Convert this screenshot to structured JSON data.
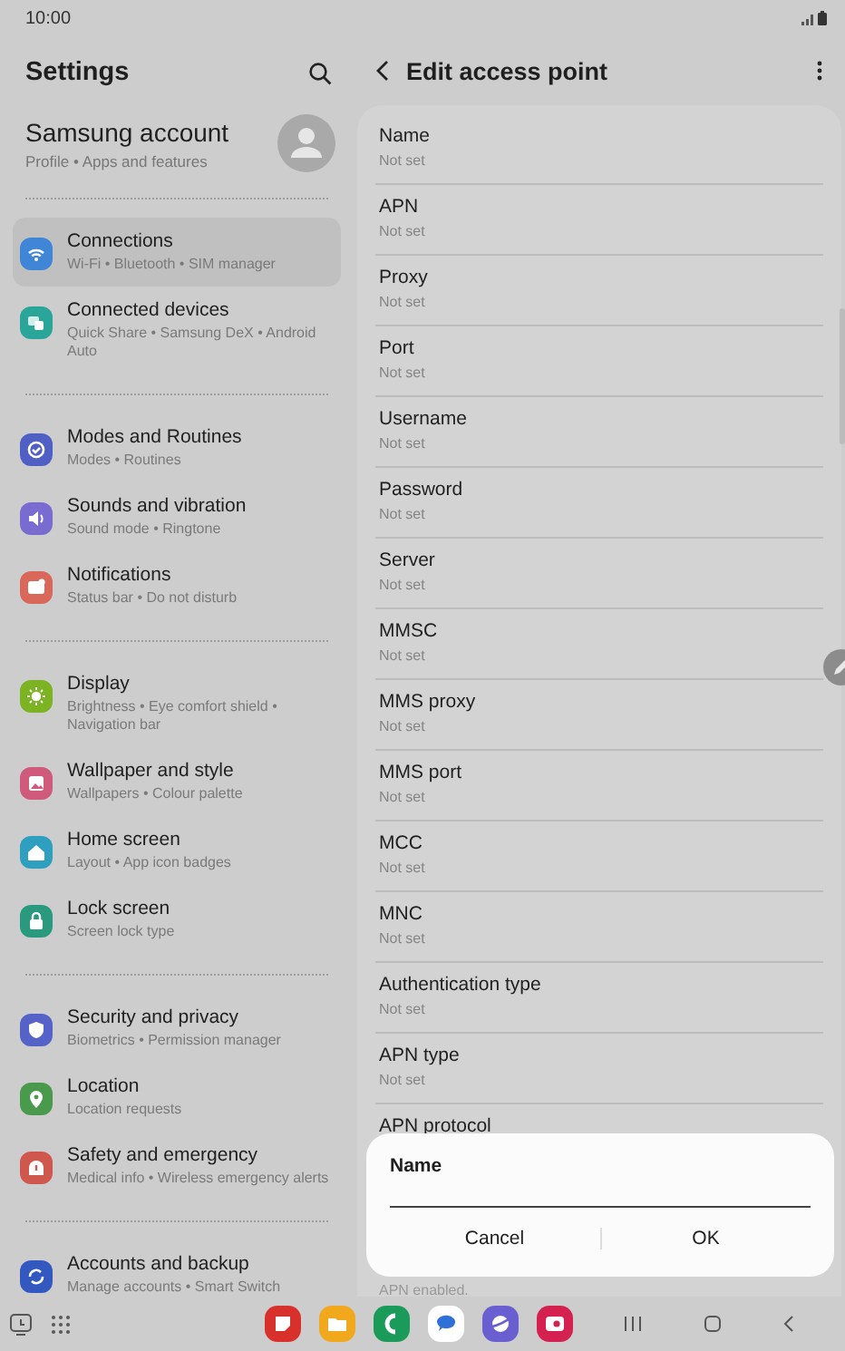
{
  "status_bar": {
    "time": "10:00"
  },
  "settings": {
    "title": "Settings",
    "account": {
      "name": "Samsung account",
      "subtitle": "Profile  •  Apps and features"
    },
    "groups": [
      [
        {
          "title": "Connections",
          "subtitle": "Wi-Fi  •  Bluetooth  •  SIM manager",
          "selected": true,
          "color": "#3f86d6"
        },
        {
          "title": "Connected devices",
          "subtitle": "Quick Share  •  Samsung DeX  •  Android Auto",
          "selected": false,
          "color": "#2aa59a"
        }
      ],
      [
        {
          "title": "Modes and Routines",
          "subtitle": "Modes  •  Routines",
          "selected": false,
          "color": "#4f5fc4"
        },
        {
          "title": "Sounds and vibration",
          "subtitle": "Sound mode  •  Ringtone",
          "selected": false,
          "color": "#7a6bd0"
        },
        {
          "title": "Notifications",
          "subtitle": "Status bar  •  Do not disturb",
          "selected": false,
          "color": "#d9675a"
        }
      ],
      [
        {
          "title": "Display",
          "subtitle": "Brightness  •  Eye comfort shield  •  Navigation bar",
          "selected": false,
          "color": "#7cb322"
        },
        {
          "title": "Wallpaper and style",
          "subtitle": "Wallpapers  •  Colour palette",
          "selected": false,
          "color": "#cf5a7c"
        },
        {
          "title": "Home screen",
          "subtitle": "Layout  •  App icon badges",
          "selected": false,
          "color": "#2f9fc0"
        },
        {
          "title": "Lock screen",
          "subtitle": "Screen lock type",
          "selected": false,
          "color": "#2a9a7e"
        }
      ],
      [
        {
          "title": "Security and privacy",
          "subtitle": "Biometrics  •  Permission manager",
          "selected": false,
          "color": "#5563c8"
        },
        {
          "title": "Location",
          "subtitle": "Location requests",
          "selected": false,
          "color": "#4a9a4e"
        },
        {
          "title": "Safety and emergency",
          "subtitle": "Medical info  •  Wireless emergency alerts",
          "selected": false,
          "color": "#cf574e"
        }
      ],
      [
        {
          "title": "Accounts and backup",
          "subtitle": "Manage accounts  •  Smart Switch",
          "selected": false,
          "color": "#3358c0"
        }
      ]
    ]
  },
  "edit": {
    "title": "Edit access point",
    "fields": [
      {
        "label": "Name",
        "value": "Not set"
      },
      {
        "label": "APN",
        "value": "Not set"
      },
      {
        "label": "Proxy",
        "value": "Not set"
      },
      {
        "label": "Port",
        "value": "Not set"
      },
      {
        "label": "Username",
        "value": "Not set"
      },
      {
        "label": "Password",
        "value": "Not set"
      },
      {
        "label": "Server",
        "value": "Not set"
      },
      {
        "label": "MMSC",
        "value": "Not set"
      },
      {
        "label": "MMS proxy",
        "value": "Not set"
      },
      {
        "label": "MMS port",
        "value": "Not set"
      },
      {
        "label": "MCC",
        "value": "Not set"
      },
      {
        "label": "MNC",
        "value": "Not set"
      },
      {
        "label": "Authentication type",
        "value": "Not set"
      },
      {
        "label": "APN type",
        "value": "Not set"
      },
      {
        "label": "APN protocol"
      }
    ],
    "footer": "APN enabled."
  },
  "dialog": {
    "title": "Name",
    "buttons": [
      "Cancel",
      "OK"
    ]
  }
}
